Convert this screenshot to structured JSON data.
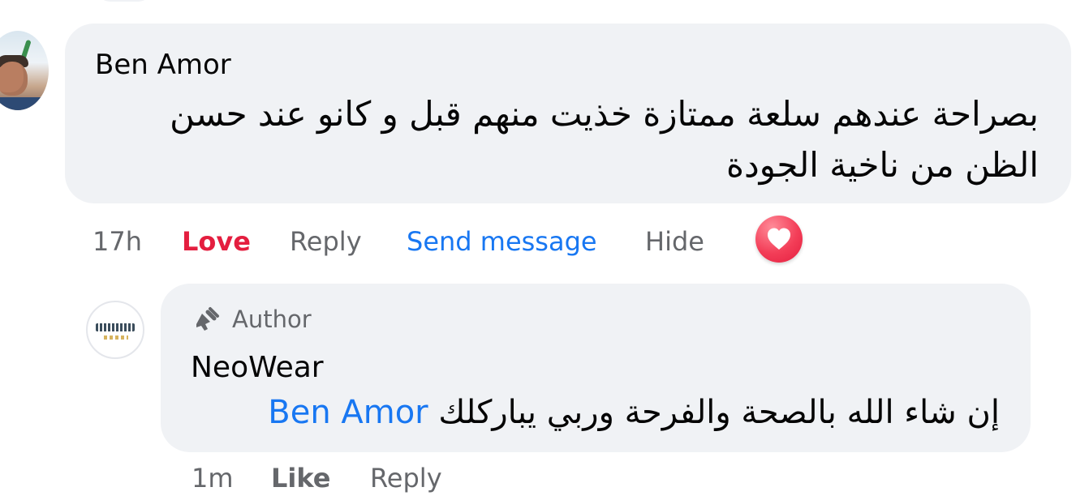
{
  "comment": {
    "author": "Ben Amor",
    "text": "بصراحة عندهم سلعة ممتازة خذيت منهم قبل و كانو عند حسن الظن من ناخية الجودة",
    "time": "17h",
    "actions": {
      "love": "Love",
      "reply": "Reply",
      "send_message": "Send message",
      "hide": "Hide"
    },
    "reaction_icon": "heart-icon"
  },
  "reply": {
    "badge": "Author",
    "author": "NeoWear",
    "mention": "Ben Amor",
    "text": "إن شاء الله بالصحة والفرحة وربي يباركلك",
    "time": "1m",
    "actions": {
      "like": "Like",
      "reply": "Reply"
    },
    "badge_icon": "megaphone-icon"
  },
  "colors": {
    "bubble": "#f0f2f5",
    "primary_text": "#050505",
    "secondary_text": "#65676b",
    "link_blue": "#1877f2",
    "love_red": "#e41e3f"
  }
}
